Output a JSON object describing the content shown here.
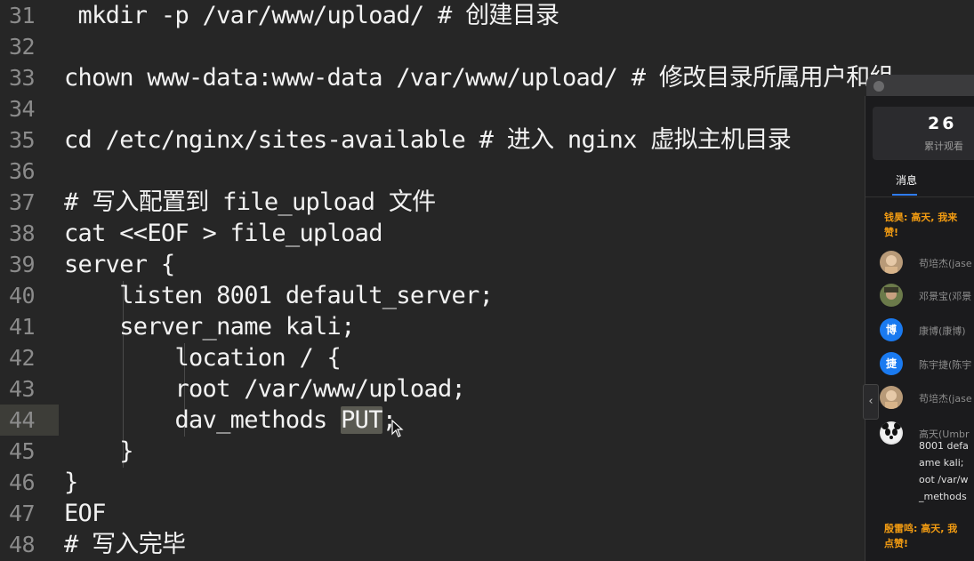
{
  "editor": {
    "lines": [
      {
        "num": "31",
        "text": " mkdir -p /var/www/upload/ # 创建目录"
      },
      {
        "num": "32",
        "text": ""
      },
      {
        "num": "33",
        "text": "chown www-data:www-data /var/www/upload/ # 修改目录所属用户和组"
      },
      {
        "num": "34",
        "text": ""
      },
      {
        "num": "35",
        "text": "cd /etc/nginx/sites-available # 进入 nginx 虚拟主机目录"
      },
      {
        "num": "36",
        "text": ""
      },
      {
        "num": "37",
        "text": "# 写入配置到 file_upload 文件"
      },
      {
        "num": "38",
        "text": "cat <<EOF > file_upload"
      },
      {
        "num": "39",
        "text": "server {"
      },
      {
        "num": "40",
        "text": "    listen 8001 default_server;"
      },
      {
        "num": "41",
        "text": "    server_name kali;"
      },
      {
        "num": "42",
        "text": "        location / {"
      },
      {
        "num": "43",
        "text": "        root /var/www/upload;"
      },
      {
        "num": "44",
        "text_before": "        dav_methods ",
        "text_sel": "PUT",
        "text_after": ";"
      },
      {
        "num": "45",
        "text": "    }"
      },
      {
        "num": "46",
        "text": "}"
      },
      {
        "num": "47",
        "text": "EOF"
      },
      {
        "num": "48",
        "text": "# 写入完毕"
      }
    ]
  },
  "live_panel": {
    "viewer_count": "26",
    "viewer_label": "累计观看",
    "tab_messages": "消息",
    "messages": [
      {
        "type": "highlight",
        "text": "钱昊: 高天, 我来\n赞!"
      },
      {
        "type": "user",
        "name": "苟培杰(jase",
        "avatar": "tan"
      },
      {
        "type": "user",
        "name": "邓景宝(邓景",
        "avatar": "green"
      },
      {
        "type": "user",
        "name": "康博(康博)",
        "avatar": "blue",
        "avatar_glyph": "博"
      },
      {
        "type": "user",
        "name": "陈宇捷(陈宇",
        "avatar": "blue",
        "avatar_glyph": "捷"
      },
      {
        "type": "user",
        "name": "苟培杰(jase",
        "avatar": "tan"
      },
      {
        "type": "user_text",
        "name": "高天(Umbr",
        "avatar": "panda",
        "text": "8001 defa\name kali;\noot /var/w\n_methods"
      },
      {
        "type": "highlight",
        "text": "殷雷鸣: 高天, 我\n点赞!"
      }
    ]
  },
  "colors": {
    "background": "#262626",
    "code_text": "#f2f2f2",
    "line_number": "#8b8b8b",
    "accent_orange": "#f39c12",
    "tab_accent": "#2f7cf6"
  }
}
